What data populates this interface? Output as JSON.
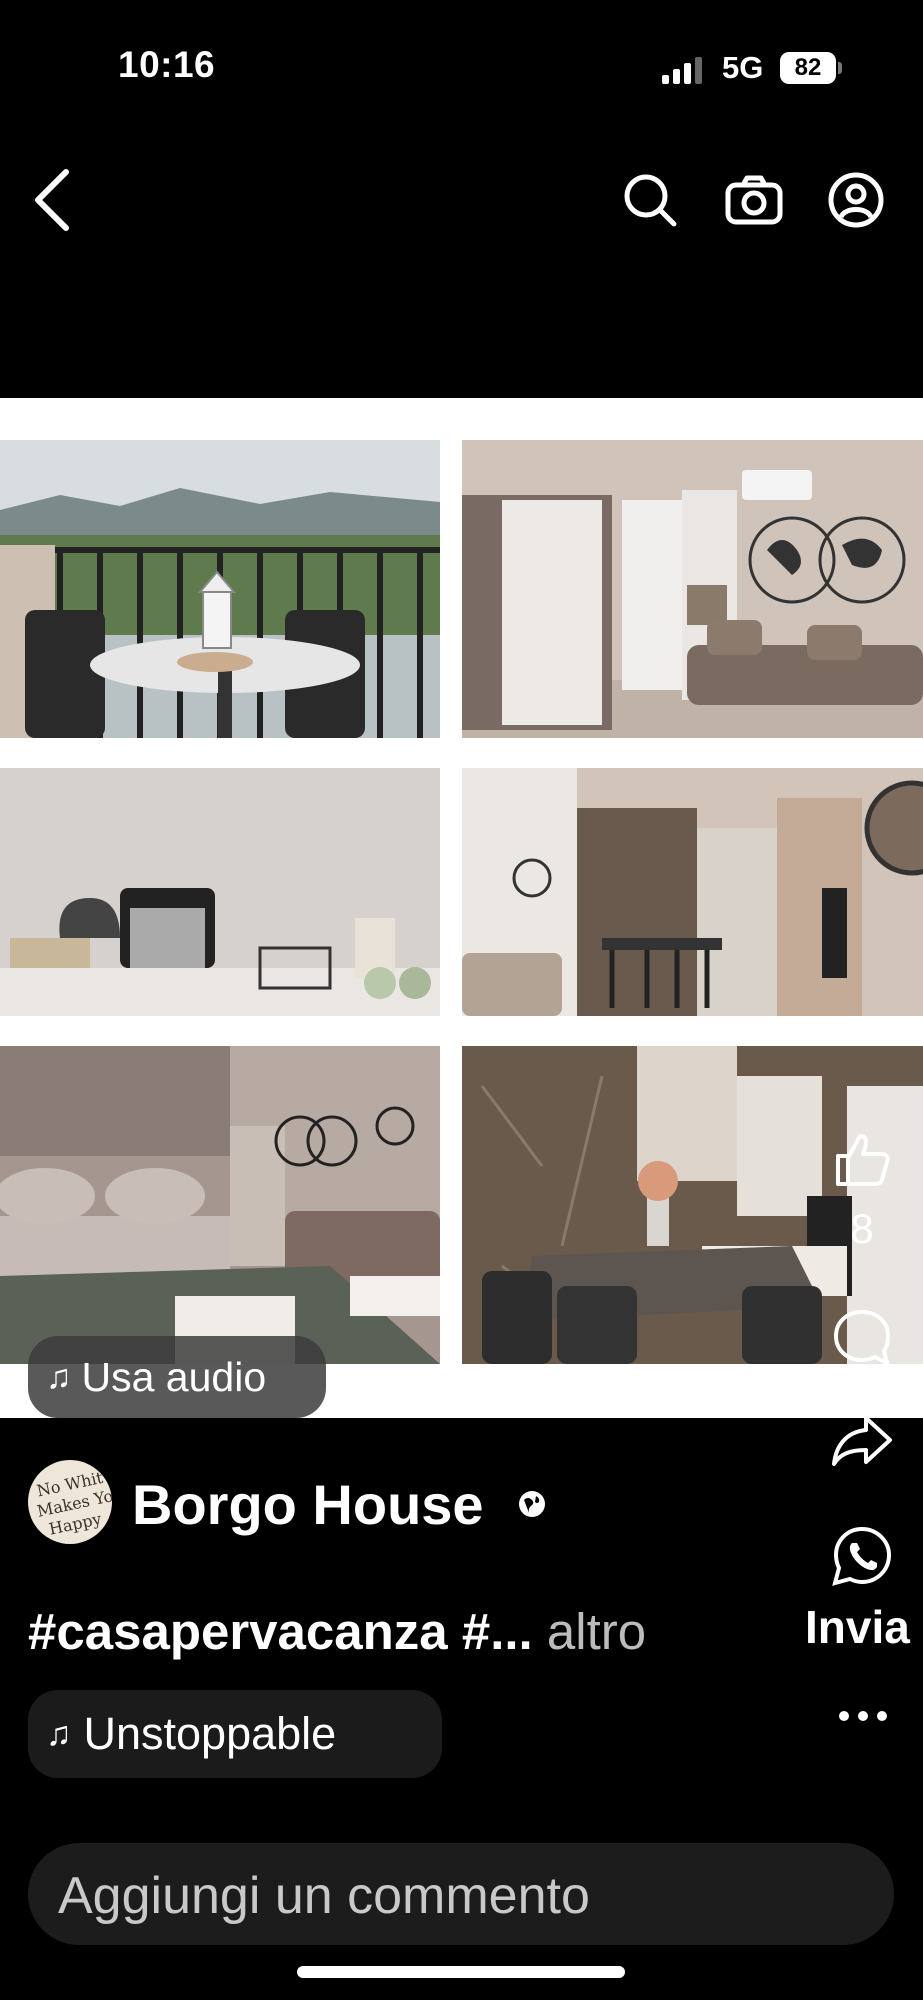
{
  "status_bar": {
    "time": "10:16",
    "network": "5G",
    "battery": "82"
  },
  "top_nav": {
    "back_icon": "chevron-left-icon",
    "search_icon": "search-icon",
    "camera_icon": "camera-icon",
    "profile_icon": "profile-icon"
  },
  "media": {
    "audio_chip": "Usa audio"
  },
  "actions": {
    "like_count": "8",
    "send_label": "Invia"
  },
  "post": {
    "username": "Borgo House",
    "avatar_text": "No Whit Makes You Happy",
    "caption_tags": "#casapervacanza #...",
    "caption_more": " altro",
    "music_label": "Unstoppable"
  },
  "comment": {
    "placeholder": "Aggiungi un commento"
  },
  "colors": {
    "background": "#000000",
    "comment_field": "#1c1c1c",
    "chip": "#3c3c3c"
  }
}
